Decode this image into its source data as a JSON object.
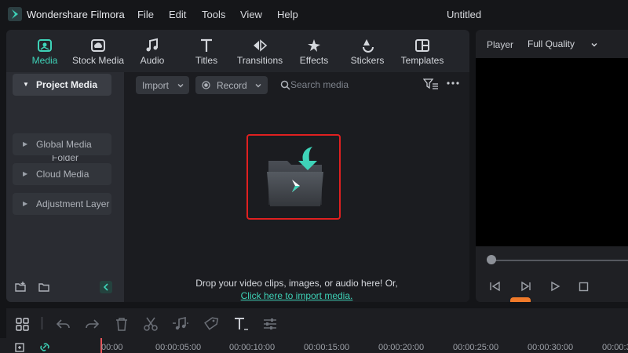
{
  "window": {
    "app_name": "Wondershare Filmora",
    "document_title": "Untitled"
  },
  "menu": [
    "File",
    "Edit",
    "Tools",
    "View",
    "Help"
  ],
  "tabs": [
    {
      "label": "Media",
      "icon": "media-icon",
      "active": true
    },
    {
      "label": "Stock Media",
      "icon": "stock-media-icon"
    },
    {
      "label": "Audio",
      "icon": "audio-icon"
    },
    {
      "label": "Titles",
      "icon": "titles-icon"
    },
    {
      "label": "Transitions",
      "icon": "transitions-icon"
    },
    {
      "label": "Effects",
      "icon": "effects-icon"
    },
    {
      "label": "Stickers",
      "icon": "stickers-icon"
    },
    {
      "label": "Templates",
      "icon": "templates-icon"
    }
  ],
  "sidebar": {
    "items": [
      {
        "label": "Project Media",
        "active": true
      },
      {
        "label": "Folder"
      },
      {
        "label": "Global Media"
      },
      {
        "label": "Cloud Media"
      },
      {
        "label": "Adjustment Layer"
      }
    ]
  },
  "toolbar": {
    "import_label": "Import",
    "record_label": "Record",
    "search_placeholder": "Search media"
  },
  "dropzone": {
    "text": "Drop your video clips, images, or audio here! Or,",
    "link": "Click here to import media."
  },
  "player": {
    "label": "Player",
    "quality": "Full Quality"
  },
  "timeline": {
    "ticks": [
      "00:00",
      "00:00:05:00",
      "00:00:10:00",
      "00:00:15:00",
      "00:00:20:00",
      "00:00:25:00",
      "00:00:30:00",
      "00:00:3"
    ]
  },
  "colors": {
    "accent": "#3ed3b8",
    "highlight_border": "#e02020",
    "playhead": "#e8555a"
  }
}
